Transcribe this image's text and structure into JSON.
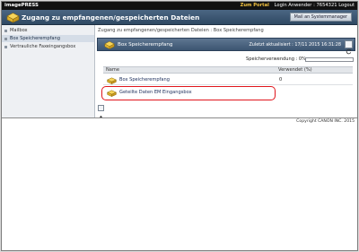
{
  "app": {
    "brand": "imagePRESS"
  },
  "topbar": {
    "portal_link": "Zum Portal",
    "user_text": "Login Anwender : 7654321",
    "logout_link": "Logout"
  },
  "header": {
    "title": "Zugang zu empfangenen/gespeicherten Dateien",
    "mail_button": "Mail an Systemmanager"
  },
  "sidebar": {
    "items": [
      {
        "label": "Mailbox"
      },
      {
        "label": "Box Speicherempfang"
      },
      {
        "label": "Vertrauliche Faxeingangsbox"
      }
    ]
  },
  "breadcrumb": {
    "text": "Zugang zu empfangenen/gespeicherten Dateien : Box Speicherempfang"
  },
  "panel": {
    "title": "Box Speicherempfang",
    "updated": "Zuletzt aktualisiert : 17/11 2015 16:31:28"
  },
  "usage": {
    "label": "Speicherverwendung : 0%",
    "fraction": 0
  },
  "table": {
    "col_name": "Name",
    "col_used": "Verwendet (%)",
    "rows": [
      {
        "name": "Box Speicherempfang",
        "used": "0",
        "highlighted": false
      },
      {
        "name": "Geteilte Daten EM Eingangsbox",
        "used": "",
        "highlighted": true
      }
    ]
  },
  "footer": {
    "copyright": "Copyright CANON INC. 2015"
  },
  "colors": {
    "header": "#2f4963",
    "panel": "#3c5571",
    "highlight": "#e0151c",
    "portal": "#f0c040"
  },
  "icons": {
    "header": "box-icon",
    "panel": "box-icon",
    "row": "box-icon",
    "refresh": "refresh-icon"
  }
}
